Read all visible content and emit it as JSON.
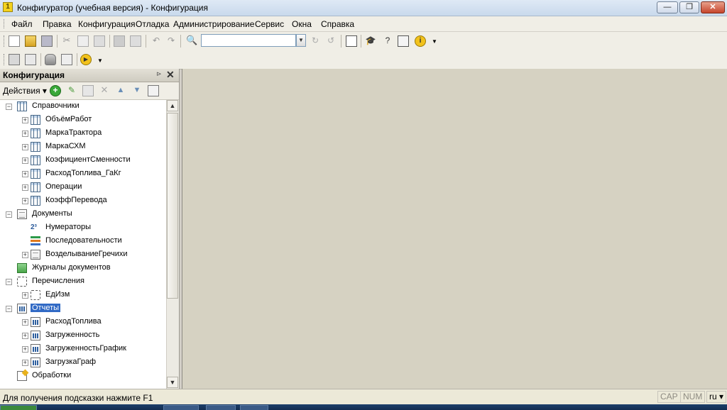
{
  "window": {
    "title": "Конфигуратор (учебная версия) - Конфигурация",
    "minimize": "—",
    "maximize": "❐",
    "close": "✕"
  },
  "menu": [
    "Файл",
    "Правка",
    "Конфигурация",
    "Отладка",
    "Администрирование",
    "Сервис",
    "Окна",
    "Справка"
  ],
  "toolbar": {
    "search_value": ""
  },
  "panel": {
    "title": "Конфигурация",
    "actions_label": "Действия ▾",
    "pin": "⊳",
    "close": "✕"
  },
  "tree": [
    {
      "label": "Справочники",
      "icon": "catalog-icon",
      "toggle": "−",
      "level": 0
    },
    {
      "label": "ОбъёмРабот",
      "icon": "catalog-icon",
      "toggle": "+",
      "level": 1
    },
    {
      "label": "МаркаТрактора",
      "icon": "catalog-icon",
      "toggle": "+",
      "level": 1
    },
    {
      "label": "МаркаСХМ",
      "icon": "catalog-icon",
      "toggle": "+",
      "level": 1
    },
    {
      "label": "КоэфициентСменности",
      "icon": "catalog-icon",
      "toggle": "+",
      "level": 1
    },
    {
      "label": "РасходТоплива_ГаКг",
      "icon": "catalog-icon",
      "toggle": "+",
      "level": 1
    },
    {
      "label": "Операции",
      "icon": "catalog-icon",
      "toggle": "+",
      "level": 1
    },
    {
      "label": "КоэффПеревода",
      "icon": "catalog-icon",
      "toggle": "+",
      "level": 1
    },
    {
      "label": "Документы",
      "icon": "document-icon",
      "toggle": "−",
      "level": 0
    },
    {
      "label": "Нумераторы",
      "icon": "numerator-icon",
      "toggle": "",
      "level": 1
    },
    {
      "label": "Последовательности",
      "icon": "sequence-icon",
      "toggle": "",
      "level": 1
    },
    {
      "label": "ВозделываниеГречихи",
      "icon": "document-icon",
      "toggle": "+",
      "level": 1
    },
    {
      "label": "Журналы документов",
      "icon": "journal-icon",
      "toggle": "",
      "level": 0
    },
    {
      "label": "Перечисления",
      "icon": "enum-icon",
      "toggle": "−",
      "level": 0
    },
    {
      "label": "ЕдИзм",
      "icon": "enum-icon",
      "toggle": "+",
      "level": 1
    },
    {
      "label": "Отчеты",
      "icon": "report-icon",
      "toggle": "−",
      "level": 0,
      "selected": true
    },
    {
      "label": "РасходТоплива",
      "icon": "report-icon",
      "toggle": "+",
      "level": 1
    },
    {
      "label": "Загруженность",
      "icon": "report-icon",
      "toggle": "+",
      "level": 1
    },
    {
      "label": "ЗагруженностьГрафик",
      "icon": "report-icon",
      "toggle": "+",
      "level": 1
    },
    {
      "label": "ЗагрузкаГраф",
      "icon": "report-icon",
      "toggle": "+",
      "level": 1
    },
    {
      "label": "Обработки",
      "icon": "processing-icon",
      "toggle": "",
      "level": 0
    }
  ],
  "scrollbar": {
    "up": "▲",
    "down": "▼"
  },
  "status": {
    "hint": "Для получения подсказки нажмите F1",
    "cap": "CAP",
    "num": "NUM",
    "lang": "ru ▾"
  }
}
